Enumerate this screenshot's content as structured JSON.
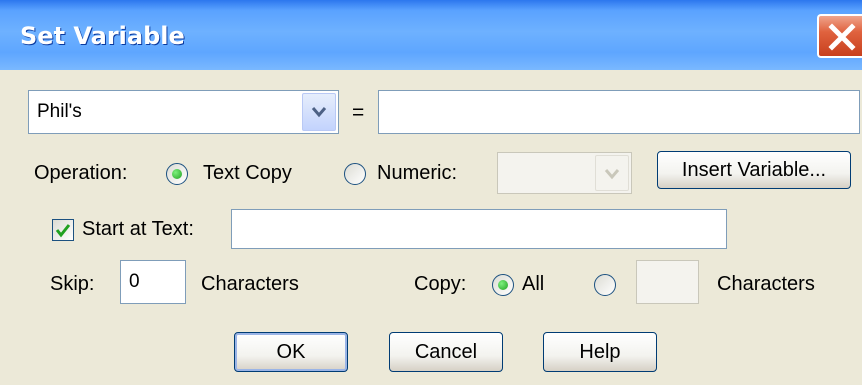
{
  "window": {
    "title": "Set Variable"
  },
  "variable": {
    "selected": "Phil's",
    "equals": "=",
    "value": ""
  },
  "operation": {
    "label": "Operation:",
    "text_copy_label": "Text Copy",
    "numeric_label": "Numeric:",
    "numeric_value": "",
    "insert_variable_label": "Insert Variable...",
    "selected": "Text Copy"
  },
  "start_at": {
    "label": "Start at Text:",
    "checked": true,
    "value": ""
  },
  "skip": {
    "label": "Skip:",
    "value": "0",
    "unit_label": "Characters"
  },
  "copy": {
    "label": "Copy:",
    "all_label": "All",
    "count_value": "",
    "unit_label": "Characters",
    "selected": "All"
  },
  "buttons": {
    "ok": "OK",
    "cancel": "Cancel",
    "help": "Help"
  }
}
